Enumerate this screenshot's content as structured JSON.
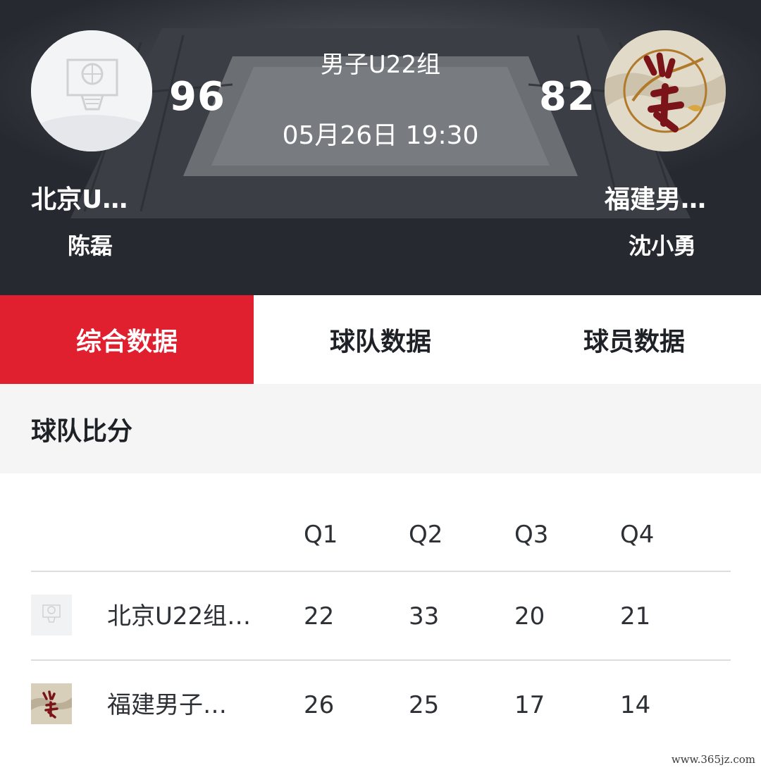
{
  "header": {
    "match_title": "男子U22组",
    "match_time": "05月26日 19:30",
    "home": {
      "score": "96",
      "name": "北京U…",
      "coach": "陈磊",
      "logo_icon": "basketball-hoop-icon"
    },
    "away": {
      "score": "82",
      "name": "福建男…",
      "coach": "沈小勇",
      "logo_icon": "fujian-calligraphy-logo"
    }
  },
  "tabs": [
    {
      "label": "综合数据",
      "active": true
    },
    {
      "label": "球队数据",
      "active": false
    },
    {
      "label": "球员数据",
      "active": false
    }
  ],
  "section": {
    "title": "球队比分"
  },
  "quarter_table": {
    "headers": [
      "Q1",
      "Q2",
      "Q3",
      "Q4"
    ],
    "rows": [
      {
        "team": "北京U22组…",
        "scores": [
          "22",
          "33",
          "20",
          "21"
        ]
      },
      {
        "team": "福建男子…",
        "scores": [
          "26",
          "25",
          "17",
          "14"
        ]
      }
    ]
  },
  "watermark": "www.365jz.com",
  "colors": {
    "accent": "#e0202f",
    "header_bg": "#262a30",
    "section_bg": "#f5f5f6"
  }
}
